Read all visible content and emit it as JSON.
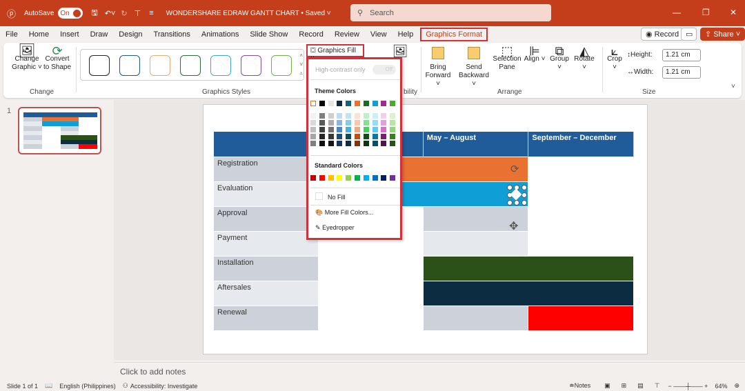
{
  "titlebar": {
    "autosave": "AutoSave",
    "autosave_state": "On",
    "doc_title": "WONDERSHARE EDRAW GANTT CHART • Saved ˅",
    "search_placeholder": "Search"
  },
  "menu": [
    "File",
    "Home",
    "Insert",
    "Draw",
    "Design",
    "Transitions",
    "Animations",
    "Slide Show",
    "Record",
    "Review",
    "View",
    "Help"
  ],
  "active_tab": "Graphics Format",
  "right_buttons": {
    "record": "Record",
    "share": "Share"
  },
  "ribbon": {
    "change_graphic": "Change Graphic ˅",
    "convert": "Convert to Shape",
    "change_group": "Change",
    "styles_group": "Graphics Styles",
    "style_colors": [
      "#222222",
      "#1f5c7a",
      "#e8a87c",
      "#2e6b3a",
      "#3fa8c8",
      "#8c4a9a",
      "#6fb04a"
    ],
    "graphics_fill": "Graphics Fill ˅",
    "accessibility_partial": "bility",
    "bring_forward": "Bring Forward ˅",
    "send_backward": "Send Backward ˅",
    "selection_pane": "Selection Pane",
    "align": "Align ˅",
    "group": "Group ˅",
    "rotate": "Rotate ˅",
    "arrange_group": "Arrange",
    "crop": "Crop ˅",
    "height_label": "Height:",
    "height_value": "1.21 cm",
    "width_label": "Width:",
    "width_value": "1.21 cm",
    "size_group": "Size"
  },
  "fill_menu": {
    "high_contrast": "High-contrast only",
    "high_contrast_state": "Off",
    "theme_heading": "Theme Colors",
    "theme_colors": [
      "#ffffff",
      "#000000",
      "#e7e6e6",
      "#0e2841",
      "#156082",
      "#e97132",
      "#196b24",
      "#0f9ed5",
      "#a02b93",
      "#4ea72e"
    ],
    "tints": [
      [
        "#f2f2f2",
        "#7f7f7f",
        "#d0cece",
        "#c5d9f1",
        "#c0e4f5",
        "#fbe2d5",
        "#c1f0c8",
        "#caeefb",
        "#f2cfee",
        "#daf2d0"
      ],
      [
        "#d9d9d9",
        "#595959",
        "#aeabab",
        "#8db3e2",
        "#83cbeb",
        "#f7c7ac",
        "#83e28e",
        "#94dcf8",
        "#e59edd",
        "#b5e6a2"
      ],
      [
        "#bfbfbf",
        "#404040",
        "#757070",
        "#4a86c8",
        "#45b0e1",
        "#f1a983",
        "#47d359",
        "#61cbf4",
        "#d86dcd",
        "#8ed973"
      ],
      [
        "#a6a6a6",
        "#262626",
        "#3a3838",
        "#1f4e79",
        "#104862",
        "#c04f15",
        "#124f1b",
        "#0b76a0",
        "#78206e",
        "#3b7d23"
      ],
      [
        "#808080",
        "#0d0d0d",
        "#171616",
        "#17375e",
        "#0b3041",
        "#803510",
        "#0c3512",
        "#074f6a",
        "#50154a",
        "#275317"
      ]
    ],
    "standard_heading": "Standard Colors",
    "standard_colors": [
      "#c00000",
      "#ff0000",
      "#ffc000",
      "#ffff00",
      "#92d050",
      "#00b050",
      "#00b0f0",
      "#0070c0",
      "#002060",
      "#7030a0"
    ],
    "no_fill": "No Fill",
    "more_colors": "More Fill Colors...",
    "eyedropper": "Eyedropper"
  },
  "slide_panel": {
    "slide_number": "1"
  },
  "gantt": {
    "headers": [
      "",
      "",
      "May – August",
      "September – December"
    ],
    "rows": [
      {
        "label": "Registration",
        "cells": [
          "#e97132",
          "#e97132",
          "#ffffff"
        ]
      },
      {
        "label": "Evaluation",
        "cells": [
          "#0f9ed5",
          "#0f9ed5",
          "#ffffff"
        ]
      },
      {
        "label": "Approval",
        "cells": [
          "#ffffff",
          "#cdd2da",
          "#ffffff"
        ]
      },
      {
        "label": "Payment",
        "cells": [
          "#ffffff",
          "#e5e8ec",
          "#ffffff"
        ]
      },
      {
        "label": "Installation",
        "cells": [
          "#ffffff",
          "#2b5118",
          "#2b5118"
        ]
      },
      {
        "label": "Aftersales",
        "cells": [
          "#ffffff",
          "#0c2d41",
          "#0c2d41"
        ]
      },
      {
        "label": "Renewal",
        "cells": [
          "#ffffff",
          "#cdd2da",
          "#ff0000"
        ]
      }
    ]
  },
  "notes_placeholder": "Click to add notes",
  "status": {
    "slide": "Slide 1 of 1",
    "language": "English (Philippines)",
    "accessibility": "Accessibility: Investigate",
    "notes": "Notes",
    "zoom": "64%"
  }
}
